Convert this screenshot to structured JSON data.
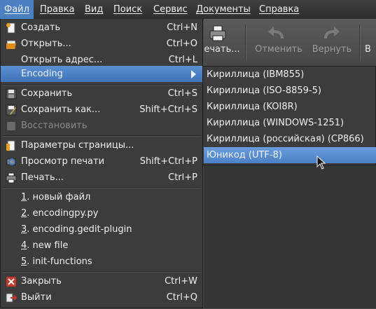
{
  "menubar": {
    "items": [
      {
        "label": "Файл"
      },
      {
        "label": "Правка"
      },
      {
        "label": "Вид"
      },
      {
        "label": "Поиск"
      },
      {
        "label": "Сервис"
      },
      {
        "label": "Документы"
      },
      {
        "label": "Справка"
      }
    ]
  },
  "toolbar": {
    "print_label": "ечать...",
    "undo_label": "Отменить",
    "redo_label": "Вернуть",
    "cut_label": "В"
  },
  "file_menu": {
    "items": [
      {
        "label": "Создать",
        "accel": "Ctrl+N",
        "icon": "new-document-icon"
      },
      {
        "label": "Открыть...",
        "accel": "Ctrl+O",
        "icon": "open-folder-icon"
      },
      {
        "label": "Открыть адрес...",
        "accel": "Ctrl+L"
      },
      {
        "label": "Encoding"
      },
      {
        "label": "Сохранить",
        "accel": "Ctrl+S",
        "icon": "save-icon"
      },
      {
        "label": "Сохранить как...",
        "accel": "Shift+Ctrl+S",
        "icon": "save-as-icon"
      },
      {
        "label": "Восстановить",
        "icon": "revert-icon"
      },
      {
        "label": "Параметры страницы...",
        "icon": "page-setup-icon"
      },
      {
        "label": "Просмотр печати",
        "accel": "Shift+Ctrl+P",
        "icon": "print-preview-icon"
      },
      {
        "label": "Печать...",
        "accel": "Ctrl+P",
        "icon": "print-icon"
      },
      {
        "num": "1",
        "label": ". новый файл"
      },
      {
        "num": "2",
        "label": ". encodingpy.py"
      },
      {
        "num": "3",
        "label": ". encoding.gedit-plugin"
      },
      {
        "num": "4",
        "label": ". new file"
      },
      {
        "num": "5",
        "label": ". init-functions"
      },
      {
        "label": "Закрыть",
        "accel": "Ctrl+W",
        "icon": "close-icon"
      },
      {
        "label": "Выйти",
        "accel": "Ctrl+Q",
        "icon": "quit-icon"
      }
    ]
  },
  "encoding_submenu": {
    "items": [
      {
        "label": "Кириллица (IBM855)"
      },
      {
        "label": "Кириллица (ISO-8859-5)"
      },
      {
        "label": "Кириллица (KOI8R)"
      },
      {
        "label": "Кириллица (WINDOWS-1251)"
      },
      {
        "label": "Кириллица (российская) (CP866)"
      },
      {
        "label": "Юникод (UTF-8)"
      }
    ]
  },
  "colors": {
    "highlight": "#4a7fc1",
    "menu_bg": "#3c3c3c",
    "menubar_bg": "#333333"
  }
}
